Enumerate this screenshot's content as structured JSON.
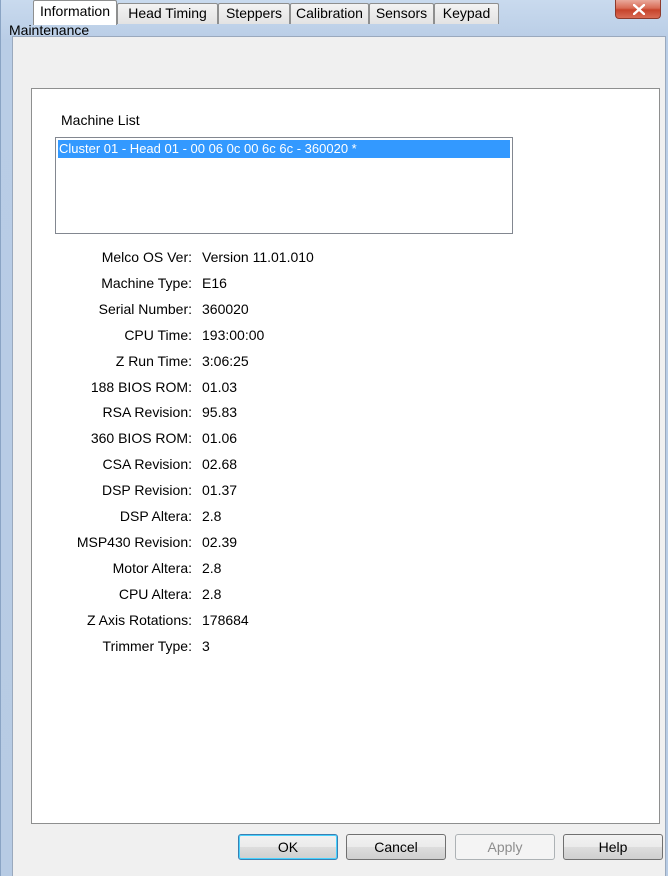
{
  "window": {
    "title": "Maintenance"
  },
  "tabs": [
    {
      "label": "Information",
      "active": true
    },
    {
      "label": "Head Timing",
      "active": false
    },
    {
      "label": "Steppers",
      "active": false
    },
    {
      "label": "Calibration",
      "active": false
    },
    {
      "label": "Sensors",
      "active": false
    },
    {
      "label": "Keypad",
      "active": false
    }
  ],
  "machine_list": {
    "label": "Machine List",
    "items": [
      "Cluster 01 - Head 01 - 00 06 0c 00 6c 6c - 360020 *"
    ],
    "selected_index": 0
  },
  "info": [
    {
      "label": "Melco OS Ver:",
      "value": "Version 11.01.010"
    },
    {
      "label": "Machine Type:",
      "value": "E16"
    },
    {
      "label": "Serial Number:",
      "value": "360020"
    },
    {
      "label": "CPU Time:",
      "value": "193:00:00"
    },
    {
      "label": "Z Run Time:",
      "value": "3:06:25"
    },
    {
      "label": "188 BIOS ROM:",
      "value": "01.03"
    },
    {
      "label": "RSA Revision:",
      "value": "95.83"
    },
    {
      "label": "360 BIOS ROM:",
      "value": "01.06"
    },
    {
      "label": "CSA Revision:",
      "value": "02.68"
    },
    {
      "label": "DSP Revision:",
      "value": "01.37"
    },
    {
      "label": "DSP Altera:",
      "value": "2.8"
    },
    {
      "label": "MSP430 Revision:",
      "value": "02.39"
    },
    {
      "label": "Motor Altera:",
      "value": "2.8"
    },
    {
      "label": "CPU Altera:",
      "value": "2.8"
    },
    {
      "label": "Z Axis Rotations:",
      "value": "178684"
    },
    {
      "label": "Trimmer Type:",
      "value": "3"
    }
  ],
  "buttons": {
    "ok": "OK",
    "cancel": "Cancel",
    "apply": "Apply",
    "help": "Help"
  },
  "colors": {
    "selection": "#3399ff",
    "close": "#c7432b"
  }
}
